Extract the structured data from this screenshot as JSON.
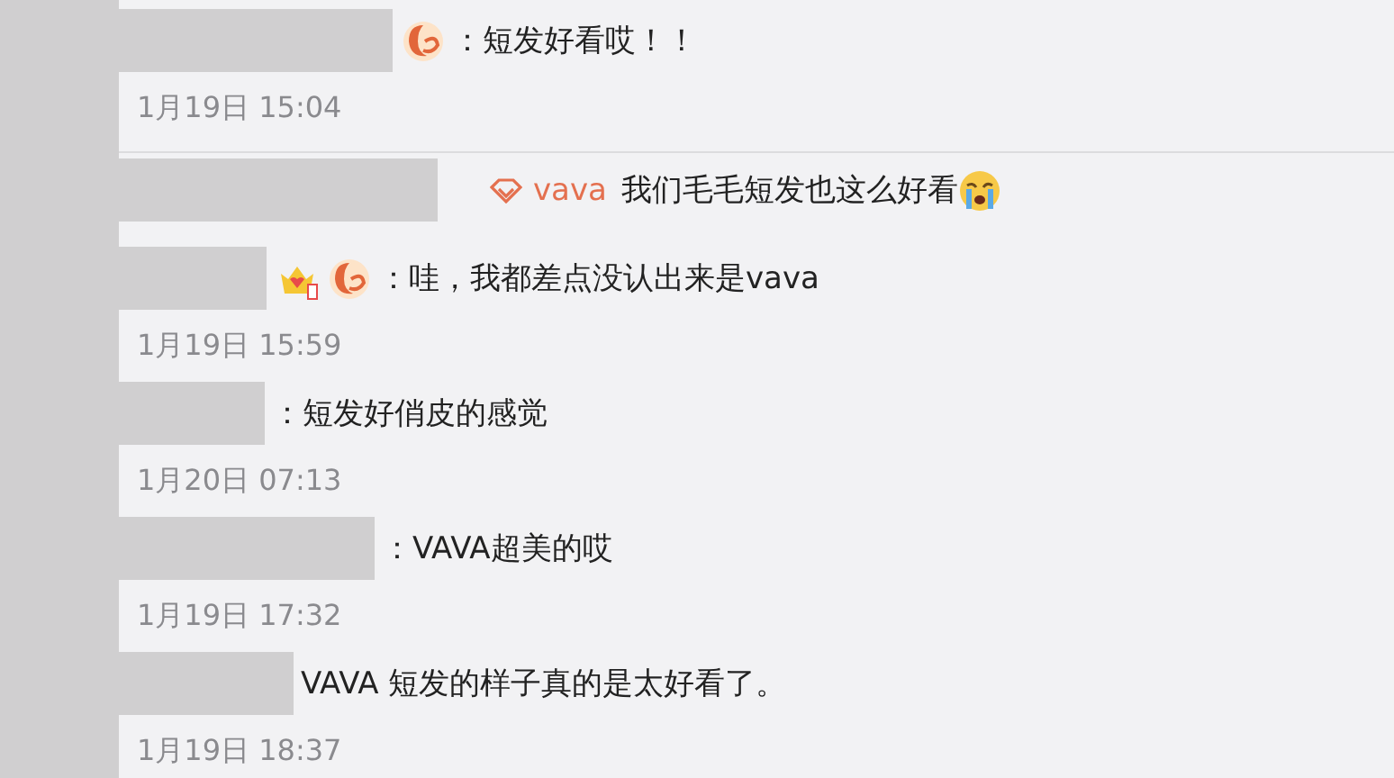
{
  "comments": [
    {
      "kind": "comment",
      "mermaid": true,
      "text": "：短发好看哎！！",
      "time": "1月19日 15:04"
    },
    {
      "kind": "reply",
      "author": "vava",
      "text": "我们毛毛短发也这么好看"
    },
    {
      "kind": "comment",
      "crown": true,
      "mermaid": true,
      "text": "：哇，我都差点没认出来是vava",
      "time": "1月19日 15:59"
    },
    {
      "kind": "comment",
      "text": "：短发好俏皮的感觉",
      "time": "1月20日 07:13"
    },
    {
      "kind": "comment",
      "text": "：VAVA超美的哎",
      "time": "1月19日 17:32"
    },
    {
      "kind": "comment",
      "text": "VAVA 短发的样子真的是太好看了。",
      "time": "1月19日 18:37"
    }
  ]
}
